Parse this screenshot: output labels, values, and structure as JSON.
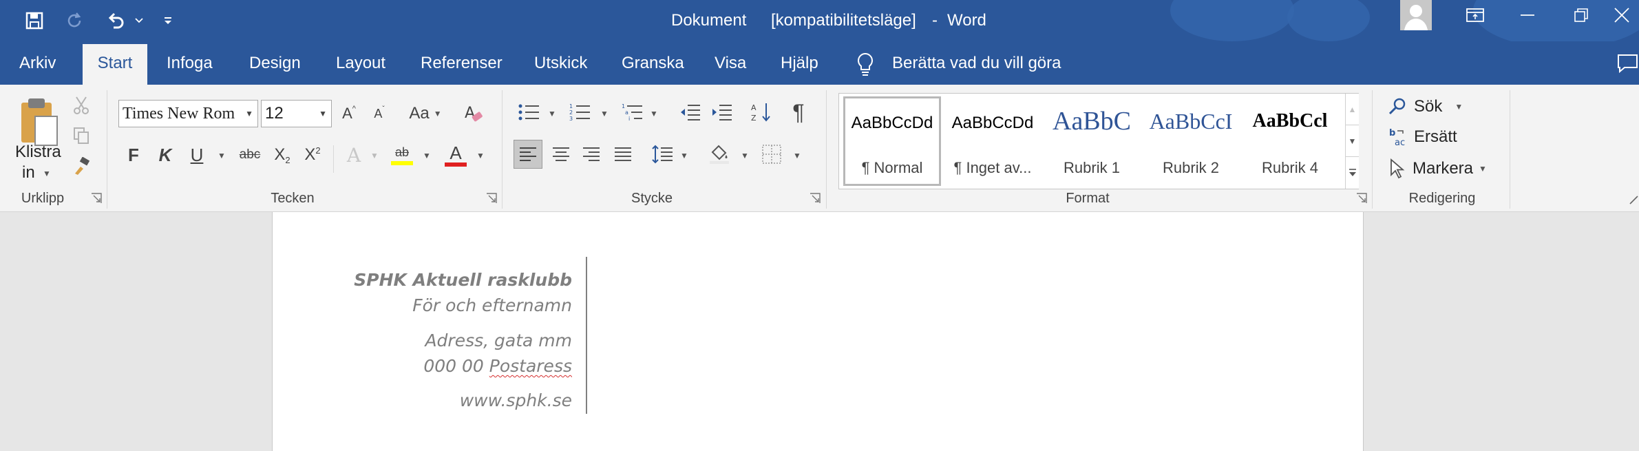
{
  "titlebar": {
    "doc_name": "Dokument",
    "mode": "[kompatibilitetsläge]",
    "app": "Word",
    "separator": "-"
  },
  "tabs": [
    {
      "label": "Arkiv"
    },
    {
      "label": "Start"
    },
    {
      "label": "Infoga"
    },
    {
      "label": "Design"
    },
    {
      "label": "Layout"
    },
    {
      "label": "Referenser"
    },
    {
      "label": "Utskick"
    },
    {
      "label": "Granska"
    },
    {
      "label": "Visa"
    },
    {
      "label": "Hjälp"
    }
  ],
  "tell_me": "Berätta vad du vill göra",
  "ribbon": {
    "clipboard": {
      "paste_label_1": "Klistra",
      "paste_label_2": "in",
      "group": "Urklipp"
    },
    "font": {
      "name": "Times New Rom",
      "size": "12",
      "group": "Tecken",
      "bold": "F",
      "italic": "K",
      "underline": "U",
      "strike": "abc",
      "sub": "X",
      "sub_mark": "2",
      "sup": "X",
      "sup_mark": "2",
      "change_case": "Aa",
      "font_color_letter": "A",
      "effects_letter": "A",
      "grow_letter": "A",
      "shrink_letter": "A",
      "highlight_letters": "ab"
    },
    "paragraph": {
      "group": "Stycke",
      "pilcrow": "¶"
    },
    "styles": {
      "group": "Format",
      "items": [
        {
          "sample": "AaBbCcDd",
          "name": "¶ Normal"
        },
        {
          "sample": "AaBbCcDd",
          "name": "¶ Inget av..."
        },
        {
          "sample": "AaBbC",
          "name": "Rubrik 1"
        },
        {
          "sample": "AaBbCcI",
          "name": "Rubrik 2"
        },
        {
          "sample": "AaBbCcl",
          "name": "Rubrik 4"
        }
      ]
    },
    "editing": {
      "group": "Redigering",
      "find": "Sök",
      "replace": "Ersätt",
      "select": "Markera"
    }
  },
  "document": {
    "lines": [
      "SPHK Aktuell rasklubb",
      "För och efternamn",
      "Adress, gata mm",
      "000 00",
      "Postaress",
      "www.sphk.se"
    ]
  },
  "colors": {
    "brand": "#2b579a",
    "highlight": "#ffff00",
    "font_color": "#e02020"
  }
}
